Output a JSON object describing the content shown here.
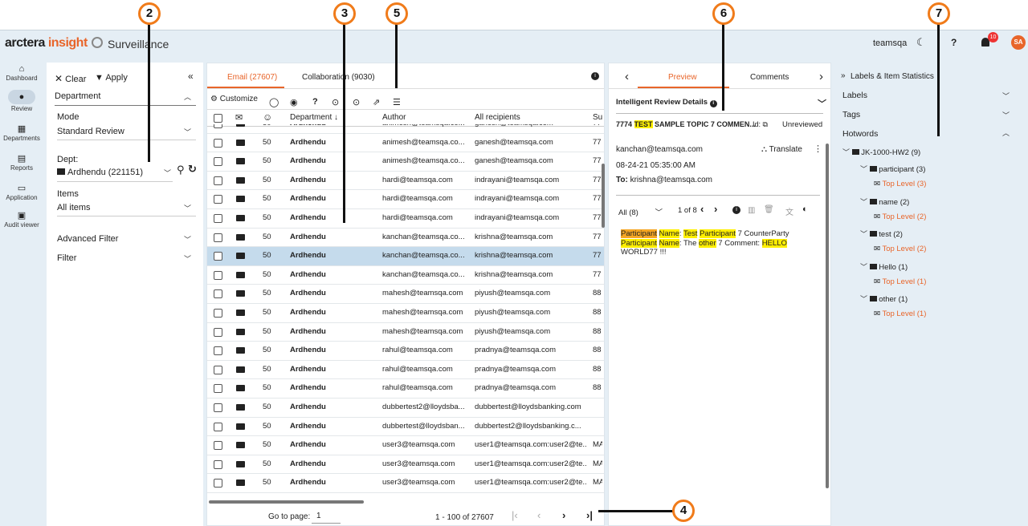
{
  "callouts": [
    "2",
    "3",
    "5",
    "6",
    "7",
    "4"
  ],
  "brand": {
    "name_a": "arctera",
    "name_b": "insight",
    "product": "Surveillance"
  },
  "header": {
    "user": "teamsqa",
    "notif_count": "10",
    "avatar": "SA",
    "moon": "☾",
    "help": "?",
    "bell": "🔔"
  },
  "rail": [
    {
      "label": "Dashboard",
      "icon": "⌂"
    },
    {
      "label": "Review",
      "icon": "●"
    },
    {
      "label": "Departments",
      "icon": "▦"
    },
    {
      "label": "Reports",
      "icon": "▤"
    },
    {
      "label": "Application",
      "icon": "▭"
    },
    {
      "label": "Audit viewer",
      "icon": "▣"
    }
  ],
  "filter": {
    "clear": "Clear",
    "apply": "Apply",
    "collapse": "«",
    "department": "Department",
    "mode_label": "Mode",
    "mode_value": "Standard Review",
    "dept_label": "Dept:",
    "dept_value": "Ardhendu (221151)",
    "items_label": "Items",
    "items_value": "All items",
    "advanced": "Advanced Filter",
    "filter": "Filter"
  },
  "grid": {
    "tab_email": "Email (27607)",
    "tab_collab": "Collaboration (9030)",
    "customize": "Customize",
    "col_department": "Department",
    "col_author": "Author",
    "col_recipients": "All recipients",
    "col_su": "Su",
    "goto": "Go to page:",
    "page": "1",
    "range": "1 - 100 of 27607",
    "rows": [
      {
        "score": "50",
        "dept": "Ardhendu",
        "author": "animesh@teamsqa.co...",
        "rcpt": "ganesh@teamsqa.com",
        "su": "77"
      },
      {
        "score": "50",
        "dept": "Ardhendu",
        "author": "animesh@teamsqa.co...",
        "rcpt": "ganesh@teamsqa.com",
        "su": "77"
      },
      {
        "score": "50",
        "dept": "Ardhendu",
        "author": "animesh@teamsqa.co...",
        "rcpt": "ganesh@teamsqa.com",
        "su": "77"
      },
      {
        "score": "50",
        "dept": "Ardhendu",
        "author": "hardi@teamsqa.com",
        "rcpt": "indrayani@teamsqa.com",
        "su": "77"
      },
      {
        "score": "50",
        "dept": "Ardhendu",
        "author": "hardi@teamsqa.com",
        "rcpt": "indrayani@teamsqa.com",
        "su": "77"
      },
      {
        "score": "50",
        "dept": "Ardhendu",
        "author": "hardi@teamsqa.com",
        "rcpt": "indrayani@teamsqa.com",
        "su": "77"
      },
      {
        "score": "50",
        "dept": "Ardhendu",
        "author": "kanchan@teamsqa.co...",
        "rcpt": "krishna@teamsqa.com",
        "su": "77"
      },
      {
        "score": "50",
        "dept": "Ardhendu",
        "author": "kanchan@teamsqa.co...",
        "rcpt": "krishna@teamsqa.com",
        "su": "77"
      },
      {
        "score": "50",
        "dept": "Ardhendu",
        "author": "kanchan@teamsqa.co...",
        "rcpt": "krishna@teamsqa.com",
        "su": "77"
      },
      {
        "score": "50",
        "dept": "Ardhendu",
        "author": "mahesh@teamsqa.com",
        "rcpt": "piyush@teamsqa.com",
        "su": "88"
      },
      {
        "score": "50",
        "dept": "Ardhendu",
        "author": "mahesh@teamsqa.com",
        "rcpt": "piyush@teamsqa.com",
        "su": "88"
      },
      {
        "score": "50",
        "dept": "Ardhendu",
        "author": "mahesh@teamsqa.com",
        "rcpt": "piyush@teamsqa.com",
        "su": "88"
      },
      {
        "score": "50",
        "dept": "Ardhendu",
        "author": "rahul@teamsqa.com",
        "rcpt": "pradnya@teamsqa.com",
        "su": "88"
      },
      {
        "score": "50",
        "dept": "Ardhendu",
        "author": "rahul@teamsqa.com",
        "rcpt": "pradnya@teamsqa.com",
        "su": "88"
      },
      {
        "score": "50",
        "dept": "Ardhendu",
        "author": "rahul@teamsqa.com",
        "rcpt": "pradnya@teamsqa.com",
        "su": "88"
      },
      {
        "score": "50",
        "dept": "Ardhendu",
        "author": "dubbertest2@lloydsba...",
        "rcpt": "dubbertest@lloydsbanking.com",
        "su": ""
      },
      {
        "score": "50",
        "dept": "Ardhendu",
        "author": "dubbertest@lloydsban...",
        "rcpt": "dubbertest2@lloydsbanking.c...",
        "su": ""
      },
      {
        "score": "50",
        "dept": "Ardhendu",
        "author": "user3@teamsqa.com",
        "rcpt": "user1@teamsqa.com:user2@te...",
        "su": "MA"
      },
      {
        "score": "50",
        "dept": "Ardhendu",
        "author": "user3@teamsqa.com",
        "rcpt": "user1@teamsqa.com:user2@te...",
        "su": "MA"
      },
      {
        "score": "50",
        "dept": "Ardhendu",
        "author": "user3@teamsqa.com",
        "rcpt": "user1@teamsqa.com:user2@te...",
        "su": "MA"
      }
    ]
  },
  "preview": {
    "tab_preview": "Preview",
    "tab_comments": "Comments",
    "details": "Intelligent Review Details",
    "subject_pre": "7774 ",
    "subject_hl": "TEST",
    "subject_post": " SAMPLE TOPIC 7 COMMEN...",
    "id_label": "Id:",
    "status": "Unreviewed",
    "from": "kanchan@teamsqa.com",
    "translate": "Translate",
    "date": "08-24-21 05:35:00 AM",
    "to_label": "To:",
    "to": "krishna@teamsqa.com",
    "all": "All (8)",
    "pager": "1 of 8",
    "b1": "Participant",
    "b2": "Name",
    "b3": ": ",
    "b4": "Test",
    "b5": "Participant",
    "b6": " 7 CounterParty",
    "b7": "Participant",
    "b8": "Name",
    "b9": ": The ",
    "b10": "other",
    "b11": " 7 Comment: ",
    "b12": "HELLO",
    "b13": "WORLD77 !!!"
  },
  "labels": {
    "title": "Labels & Item Statistics",
    "labels": "Labels",
    "tags": "Tags",
    "hotwords": "Hotwords",
    "root": "JK-1000-HW2 (9)",
    "groups": [
      {
        "name": "participant (3)",
        "child": "Top Level (3)"
      },
      {
        "name": "name (2)",
        "child": "Top Level (2)"
      },
      {
        "name": "test (2)",
        "child": "Top Level (2)"
      },
      {
        "name": "Hello (1)",
        "child": "Top Level (1)"
      },
      {
        "name": "other (1)",
        "child": "Top Level (1)"
      }
    ]
  }
}
